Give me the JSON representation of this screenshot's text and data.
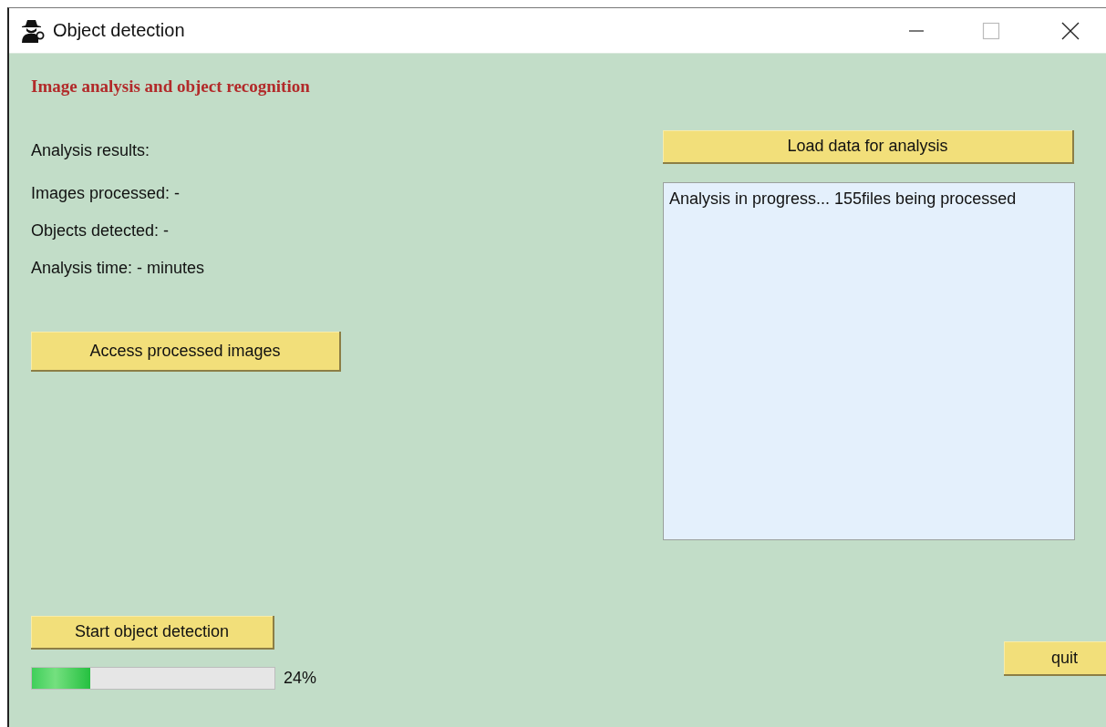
{
  "window": {
    "title": "Object detection"
  },
  "heading": "Image analysis and object recognition",
  "results": {
    "label": "Analysis results:",
    "lines": [
      "Images processed: -",
      "Objects detected: -",
      "Analysis time: - minutes"
    ]
  },
  "buttons": {
    "access": "Access processed images",
    "load": "Load data for analysis",
    "start": "Start object detection",
    "quit": "quit"
  },
  "log": {
    "text": "Analysis in progress... 155files being processed"
  },
  "progress": {
    "level": 0.24,
    "reading": "24%"
  }
}
